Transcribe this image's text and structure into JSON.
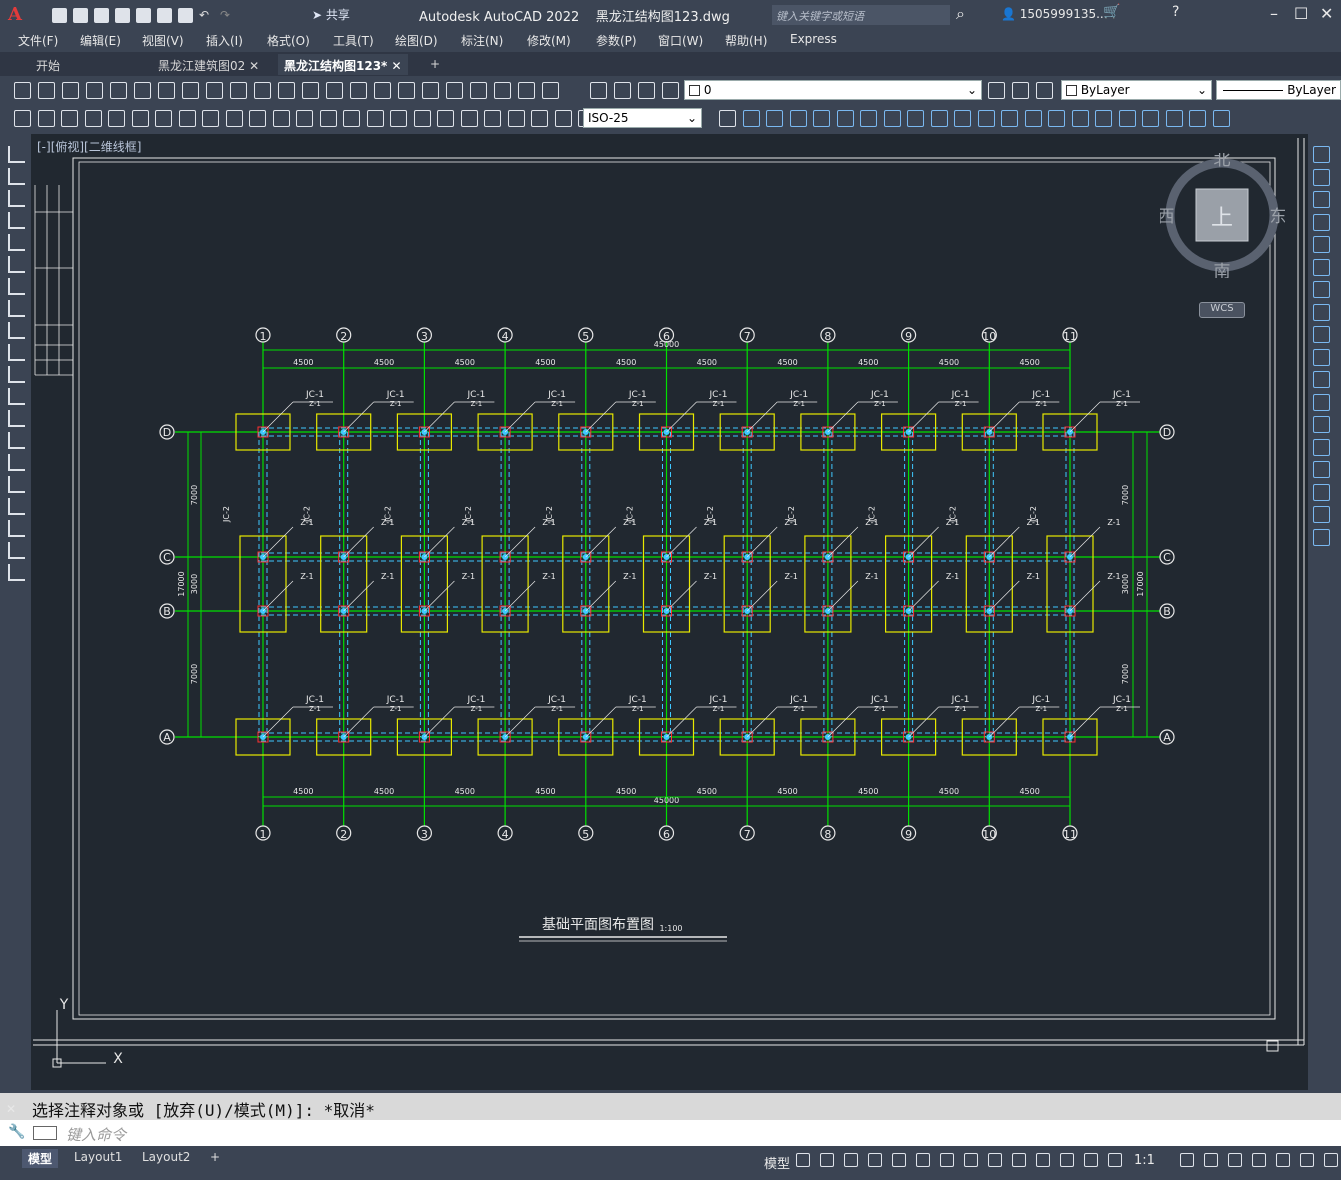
{
  "app": {
    "title": "Autodesk AutoCAD 2022",
    "filename": "黑龙江结构图123.dwg",
    "share_label": "共享",
    "search_placeholder": "键入关键字或短语",
    "user": "1505999135...",
    "logo": "A"
  },
  "menu": [
    "文件(F)",
    "编辑(E)",
    "视图(V)",
    "插入(I)",
    "格式(O)",
    "工具(T)",
    "绘图(D)",
    "标注(N)",
    "修改(M)",
    "参数(P)",
    "窗口(W)",
    "帮助(H)",
    "Express"
  ],
  "tabs": [
    {
      "label": "开始",
      "active": false
    },
    {
      "label": "黑龙江建筑图02",
      "active": false
    },
    {
      "label": "黑龙江结构图123*",
      "active": true
    }
  ],
  "layer_combo": "0",
  "color_combo": "ByLayer",
  "linetype_combo": "ByLayer",
  "dimstyle_combo": "ISO-25",
  "viewport_label": "[-][俯视][二维线框]",
  "viewcube": {
    "north": "北",
    "south": "南",
    "east": "东",
    "west": "西",
    "top": "上",
    "wcs": "WCS"
  },
  "ucs": {
    "x": "X",
    "y": "Y"
  },
  "drawing": {
    "title": "基础平面图布置图",
    "scale": "1:100",
    "total_dim": "45000",
    "bay_dim": "4500",
    "axes_num": [
      "1",
      "2",
      "3",
      "4",
      "5",
      "6",
      "7",
      "8",
      "9",
      "10",
      "11"
    ],
    "axes_letter": [
      "D",
      "C",
      "B",
      "A"
    ],
    "jc1": "JC-1",
    "z1": "Z-1",
    "jc2": "JC-2",
    "z2": "Z-2",
    "dim_7000": "7000",
    "dim_3000": "3000",
    "dim_17000": "17000"
  },
  "command": {
    "history": "选择注释对象或 [放弃(U)/模式(M)]: *取消*",
    "placeholder": "键入命令"
  },
  "layouts": [
    {
      "label": "模型",
      "active": true
    },
    {
      "label": "Layout1",
      "active": false
    },
    {
      "label": "Layout2",
      "active": false
    }
  ],
  "status": {
    "model": "模型",
    "scale": "1:1"
  },
  "colors": {
    "background": "#212830",
    "axis": "#00e000",
    "footing": "#e8e800",
    "beam": "#40c8ff",
    "column": "#ff3030"
  }
}
